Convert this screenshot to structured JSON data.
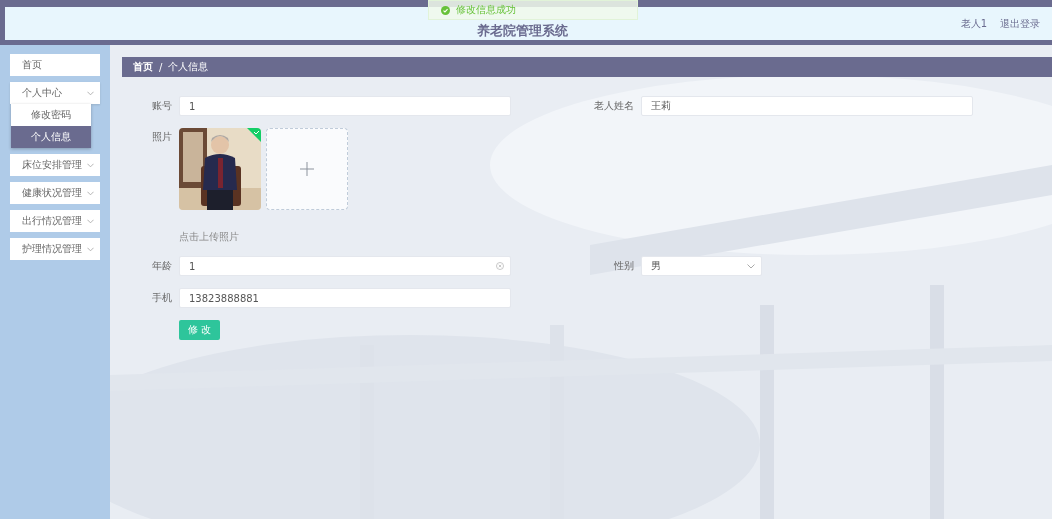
{
  "header": {
    "title": "养老院管理系统",
    "user": "老人1",
    "logout": "退出登录"
  },
  "toast": {
    "message": "修改信息成功"
  },
  "sidebar": {
    "items": [
      {
        "label": "首页",
        "kind": "link"
      },
      {
        "label": "个人中心",
        "kind": "group",
        "expanded": true,
        "children": [
          {
            "label": "修改密码",
            "selected": false
          },
          {
            "label": "个人信息",
            "selected": true
          }
        ]
      },
      {
        "label": "床位安排管理",
        "kind": "group"
      },
      {
        "label": "健康状况管理",
        "kind": "group"
      },
      {
        "label": "出行情况管理",
        "kind": "group"
      },
      {
        "label": "护理情况管理",
        "kind": "group"
      }
    ]
  },
  "breadcrumb": {
    "items": [
      "首页",
      "个人信息"
    ],
    "separator": "/"
  },
  "form": {
    "account": {
      "label": "账号",
      "value": "1"
    },
    "name": {
      "label": "老人姓名",
      "value": "王莉"
    },
    "photo": {
      "label": "照片",
      "uploaded": true,
      "hint": "点击上传照片"
    },
    "age": {
      "label": "年龄",
      "value": "1"
    },
    "gender": {
      "label": "性别",
      "value": "男"
    },
    "phone": {
      "label": "手机",
      "value": "13823888881"
    },
    "submit": "修 改"
  }
}
